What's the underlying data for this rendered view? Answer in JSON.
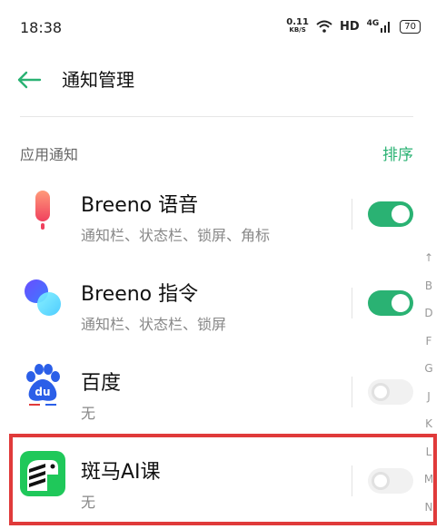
{
  "status": {
    "time": "18:38",
    "net_speed": "0.11",
    "net_unit": "KB/S",
    "hd": "HD",
    "network": "4G",
    "battery": "70"
  },
  "header": {
    "title": "通知管理"
  },
  "section": {
    "title": "应用通知",
    "sort_label": "排序"
  },
  "apps": [
    {
      "name": "Breeno 语音",
      "desc": "通知栏、状态栏、锁屏、角标",
      "enabled": true
    },
    {
      "name": "Breeno 指令",
      "desc": "通知栏、状态栏、锁屏",
      "enabled": true
    },
    {
      "name": "百度",
      "desc": "无",
      "enabled": false
    },
    {
      "name": "斑马AI课",
      "desc": "无",
      "enabled": false
    }
  ],
  "alpha_index": [
    "↑",
    "B",
    "D",
    "F",
    "G",
    "J",
    "K",
    "L",
    "M",
    "N"
  ],
  "colors": {
    "accent": "#2ab273",
    "highlight": "#e03a3a"
  }
}
